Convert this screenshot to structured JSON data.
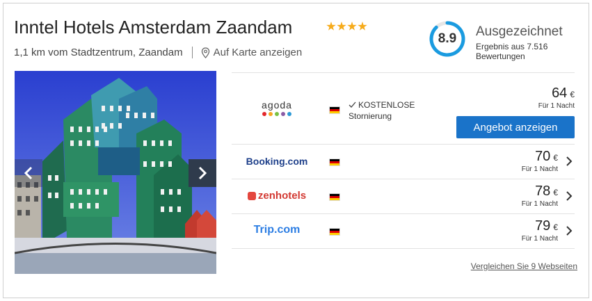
{
  "hotel": {
    "name": "Inntel Hotels Amsterdam Zaandam",
    "stars": 4,
    "distance": "1,1 km vom Stadtzentrum, Zaandam",
    "map_link": "Auf Karte anzeigen"
  },
  "rating": {
    "score": "8.9",
    "label": "Ausgezeichnet",
    "sub": "Ergebnis aus 7.516 Bewertungen",
    "accent": "#1a9be0"
  },
  "gallery": {
    "prev_icon": "chevron-left-icon",
    "next_icon": "chevron-right-icon"
  },
  "offers": [
    {
      "provider": "agoda",
      "flag": "germany-flag-icon",
      "cancel_prefix": "KOSTENLOSE",
      "cancel_suffix": "Stornierung",
      "price": "64",
      "currency": "€",
      "per_night": "Für 1 Nacht",
      "button": "Angebot anzeigen"
    },
    {
      "provider": "Booking.com",
      "flag": "germany-flag-icon",
      "price": "70",
      "currency": "€",
      "per_night": "Für 1 Nacht"
    },
    {
      "provider": "zenhotels",
      "flag": "germany-flag-icon",
      "price": "78",
      "currency": "€",
      "per_night": "Für 1 Nacht"
    },
    {
      "provider": "Trip.com",
      "flag": "germany-flag-icon",
      "price": "79",
      "currency": "€",
      "per_night": "Für 1 Nacht"
    }
  ],
  "compare_link": "Vergleichen Sie 9 Webseiten",
  "colors": {
    "button": "#1a73c9",
    "star": "#f6ab1b"
  }
}
